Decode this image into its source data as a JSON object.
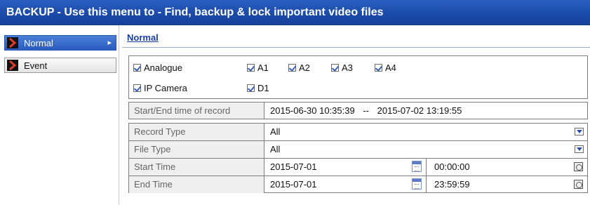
{
  "window": {
    "title": "BACKUP - Use this menu to - Find, backup & lock important video files"
  },
  "sidebar": {
    "items": [
      {
        "label": "Normal",
        "active": true
      },
      {
        "label": "Event",
        "active": false
      }
    ]
  },
  "tab": {
    "label": "Normal"
  },
  "channels": {
    "analogue": {
      "label": "Analogue",
      "checked": true
    },
    "analogue_channels": [
      {
        "label": "A1",
        "checked": true
      },
      {
        "label": "A2",
        "checked": true
      },
      {
        "label": "A3",
        "checked": true
      },
      {
        "label": "A4",
        "checked": true
      }
    ],
    "ip_camera": {
      "label": "IP Camera",
      "checked": true
    },
    "ip_channels": [
      {
        "label": "D1",
        "checked": true
      }
    ]
  },
  "record_range": {
    "label": "Start/End time of record",
    "start": "2015-06-30  10:35:39",
    "separator": "--",
    "end": "2015-07-02  13:19:55"
  },
  "form": {
    "record_type": {
      "label": "Record Type",
      "value": "All"
    },
    "file_type": {
      "label": "File Type",
      "value": "All"
    },
    "start_time": {
      "label": "Start Time",
      "date": "2015-07-01",
      "time": "00:00:00"
    },
    "end_time": {
      "label": "End Time",
      "date": "2015-07-01",
      "time": "23:59:59"
    }
  },
  "colors": {
    "titlebar": "#1a49a8",
    "active_item": "#2b5cc0",
    "accent_text": "#1a3fa0"
  }
}
